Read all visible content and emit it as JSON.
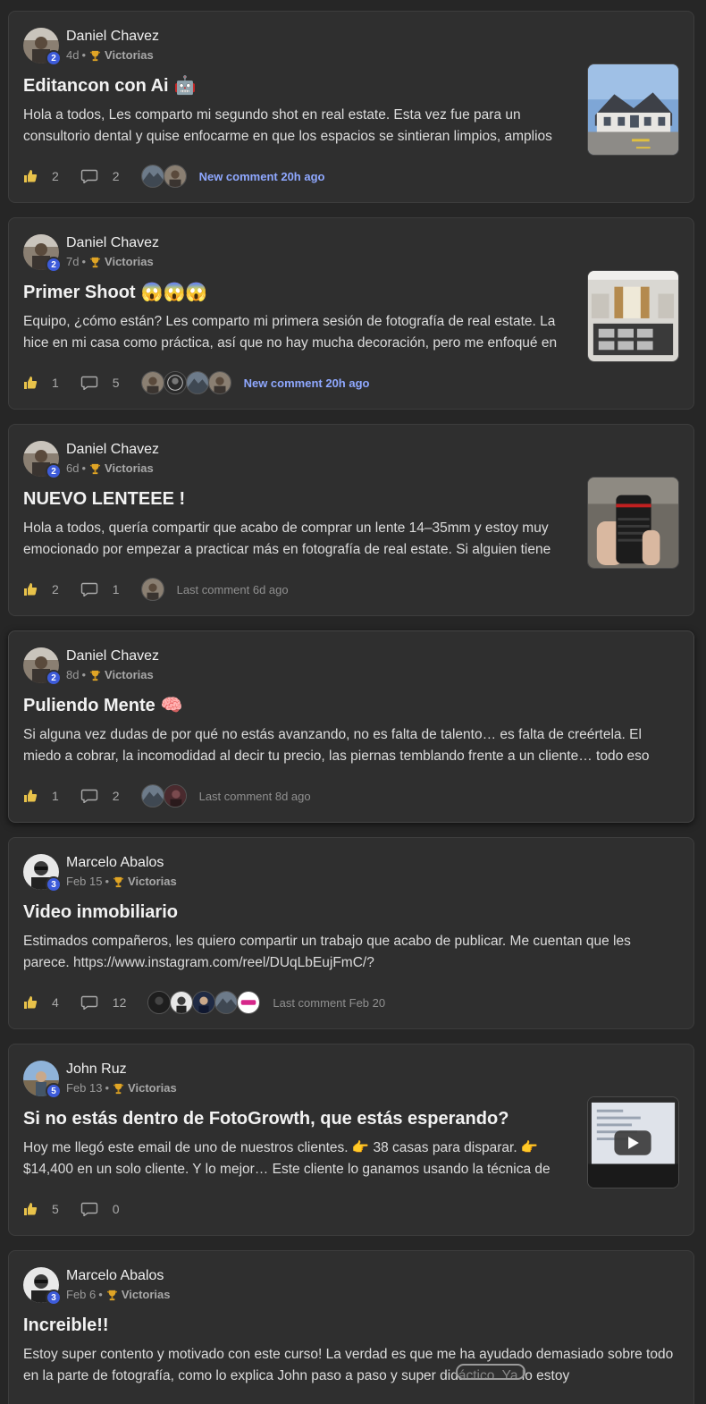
{
  "posts": [
    {
      "author": "Daniel Chavez",
      "level": "2",
      "age": "4d",
      "category": "Victorias",
      "title": "Editancon con Ai",
      "emoji": "🤖",
      "excerpt": "Hola a todos, Les comparto mi segundo shot en real estate. Esta vez fue para un consultorio dental y quise enfocarme en que los espacios se sintieran limpios, amplios",
      "likes": "2",
      "comments": "2",
      "activity": "New comment 20h ago",
      "activity_new": true,
      "thumbnail": "house-exterior"
    },
    {
      "author": "Daniel Chavez",
      "level": "2",
      "age": "7d",
      "category": "Victorias",
      "title": "Primer Shoot",
      "emoji": "😱😱😱",
      "excerpt": "Equipo, ¿cómo están? Les comparto mi primera sesión de fotografía de real estate. La hice en mi casa como práctica, así que no hay mucha decoración, pero me enfoqué en",
      "likes": "1",
      "comments": "5",
      "activity": "New comment 20h ago",
      "activity_new": true,
      "thumbnail": "kitchen-interior"
    },
    {
      "author": "Daniel Chavez",
      "level": "2",
      "age": "6d",
      "category": "Victorias",
      "title": "NUEVO LENTEEE !",
      "emoji": "",
      "excerpt": "Hola a todos, quería compartir que acabo de comprar un lente 14–35mm y estoy muy emocionado por empezar a practicar más en fotografía de real estate. Si alguien tiene",
      "likes": "2",
      "comments": "1",
      "activity": "Last comment 6d ago",
      "activity_new": false,
      "thumbnail": "camera-lens"
    },
    {
      "author": "Daniel Chavez",
      "level": "2",
      "age": "8d",
      "category": "Victorias",
      "title": "Puliendo Mente",
      "emoji": "🧠",
      "excerpt": "Si alguna vez dudas de por qué no estás avanzando, no es falta de talento… es falta de creértela. El miedo a cobrar, la incomodidad al decir tu precio, las piernas temblando frente a un cliente… todo eso",
      "likes": "1",
      "comments": "2",
      "activity": "Last comment 8d ago",
      "activity_new": false,
      "thumbnail": ""
    },
    {
      "author": "Marcelo Abalos",
      "level": "3",
      "age": "Feb 15",
      "category": "Victorias",
      "title": "Video inmobiliario",
      "emoji": "",
      "excerpt": "Estimados compañeros, les quiero compartir un trabajo que acabo de publicar. Me cuentan que les parece. https://www.instagram.com/reel/DUqLbEujFmC/?",
      "likes": "4",
      "comments": "12",
      "activity": "Last comment Feb 20",
      "activity_new": false,
      "thumbnail": ""
    },
    {
      "author": "John Ruz",
      "level": "5",
      "age": "Feb 13",
      "category": "Victorias",
      "title": "Si no estás dentro de FotoGrowth, que estás esperando?",
      "emoji": "",
      "excerpt": "Hoy me llegó este email de uno de nuestros clientes. 👉 38 casas para disparar. 👉 $14,400 en un solo cliente. Y lo mejor… Este cliente lo ganamos usando la técnica de",
      "likes": "5",
      "comments": "0",
      "activity": "",
      "activity_new": false,
      "thumbnail": "video-laptop"
    },
    {
      "author": "Marcelo Abalos",
      "level": "3",
      "age": "Feb 6",
      "category": "Victorias",
      "title": "Increible!!",
      "emoji": "",
      "excerpt": "Estoy super contento y motivado con este curso! La verdad es que me ha ayudado demasiado sobre todo en la parte de fotografía, como lo explica John paso a paso y super didáctico. Ya lo estoy",
      "likes": "",
      "comments": "",
      "activity": "",
      "activity_new": false,
      "thumbnail": ""
    }
  ],
  "icons": {
    "like": "thumbs-up-icon",
    "comment": "comment-bubble-icon",
    "trophy": "trophy-icon"
  },
  "colors": {
    "accent_link": "#8fa8ff",
    "level_badge": "#3d5bd9",
    "card_bg": "#2f2f2f"
  }
}
